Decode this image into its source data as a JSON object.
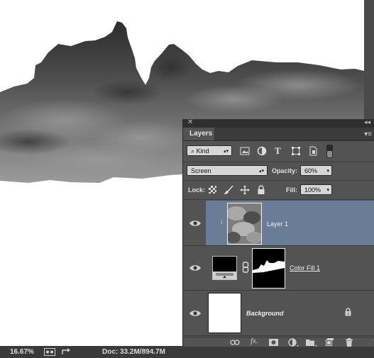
{
  "status_bar": {
    "zoom": "16.67%",
    "doc": "Doc: 33.2M/894.7M"
  },
  "layers_panel": {
    "tab_label": "Layers",
    "filter_kind": "Kind",
    "blend_mode": "Screen",
    "opacity_label": "Opacity:",
    "opacity_value": "60%",
    "lock_label": "Lock:",
    "fill_label": "Fill:",
    "fill_value": "100%",
    "layers": [
      {
        "name": "Layer 1",
        "selected": true,
        "clipped": true
      },
      {
        "name": "Color Fill 1",
        "selected": false,
        "has_mask": true
      },
      {
        "name": "Background",
        "selected": false,
        "locked": true
      }
    ]
  },
  "colors": {
    "selected_row": "#6a7d96",
    "panel_bg": "#535353",
    "status_bg": "#3a3a3a"
  }
}
